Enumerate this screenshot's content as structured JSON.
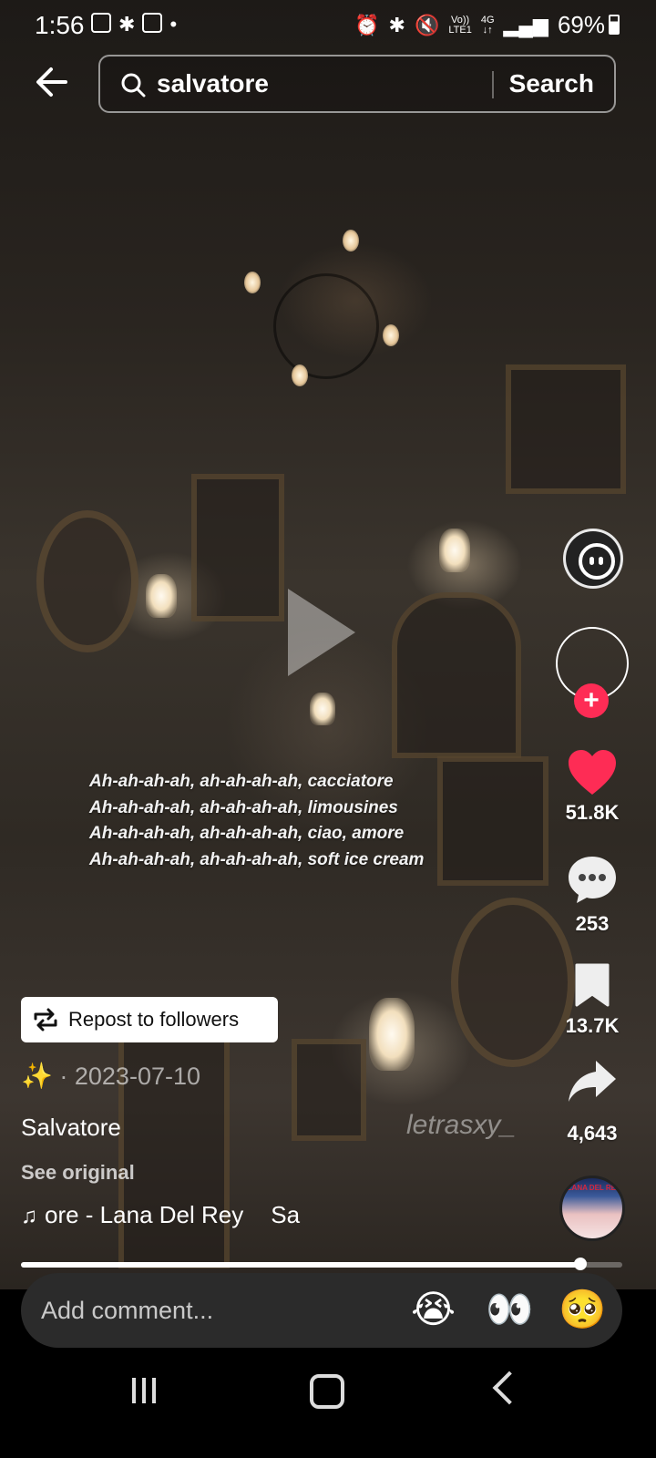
{
  "status_bar": {
    "time": "1:56",
    "network_top": "Vo))",
    "network_bottom": "LTE1",
    "data_top": "4G",
    "data_bottom": "↓↑",
    "battery_percent": "69%"
  },
  "search": {
    "query": "salvatore",
    "button_label": "Search"
  },
  "lyrics": [
    "Ah-ah-ah-ah, ah-ah-ah-ah, cacciatore",
    "Ah-ah-ah-ah, ah-ah-ah-ah, limousines",
    "Ah-ah-ah-ah, ah-ah-ah-ah, ciao, amore",
    "Ah-ah-ah-ah, ah-ah-ah-ah, soft ice cream"
  ],
  "watermark": "letrasxy_",
  "actions": {
    "likes": "51.8K",
    "comments": "253",
    "saves": "13.7K",
    "shares": "4,643"
  },
  "post": {
    "repost_label": "Repost to followers",
    "emoji": "✨",
    "date": "· 2023-07-10",
    "caption": "Salvatore",
    "see_original": "See original",
    "music_part1": "ore - Lana Del Rey",
    "music_part2": "Sa"
  },
  "music_disc_text": "LANA DEL REY",
  "progress": {
    "fraction": 0.93
  },
  "comment": {
    "placeholder": "Add comment...",
    "emoji_1": "😭",
    "emoji_2": "👀",
    "emoji_3": "🥺"
  },
  "colors": {
    "like": "#fe2c55",
    "follow_plus": "#fe2c55",
    "comment_box": "#2b2b2b"
  }
}
